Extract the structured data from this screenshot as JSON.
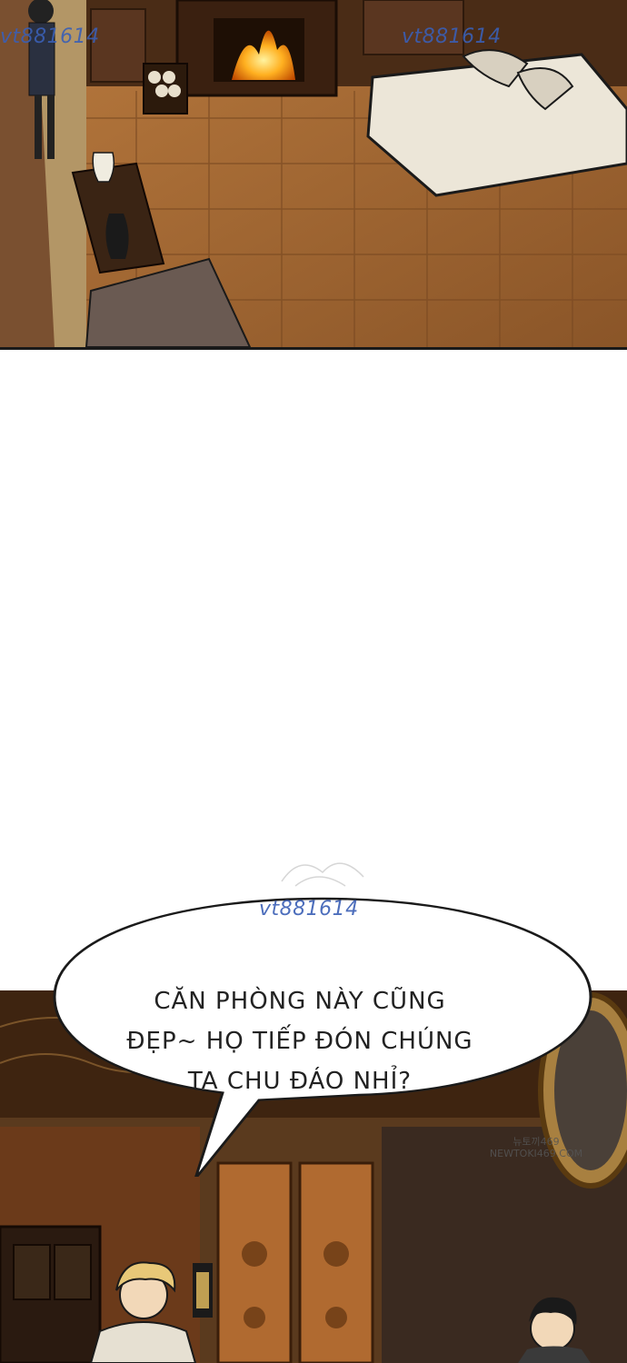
{
  "watermarks": {
    "top_left": "vt881614",
    "top_right": "vt881614",
    "middle": "vt881614"
  },
  "speech_bubble": {
    "line1": "CĂN PHÒNG NÀY CŨNG",
    "line2": "ĐẸP~ HỌ TIẾP ĐÓN CHÚNG",
    "line3": "TA CHU ĐÁO NHỈ?"
  },
  "site_mark": {
    "line1": "뉴토끼469",
    "line2": "NEWTOKI469.COM"
  },
  "colors": {
    "floor": "#a86a34",
    "bubble_fill": "#ffffff",
    "bubble_stroke": "#1a1a1a",
    "watermark": "#3a5fb5"
  }
}
